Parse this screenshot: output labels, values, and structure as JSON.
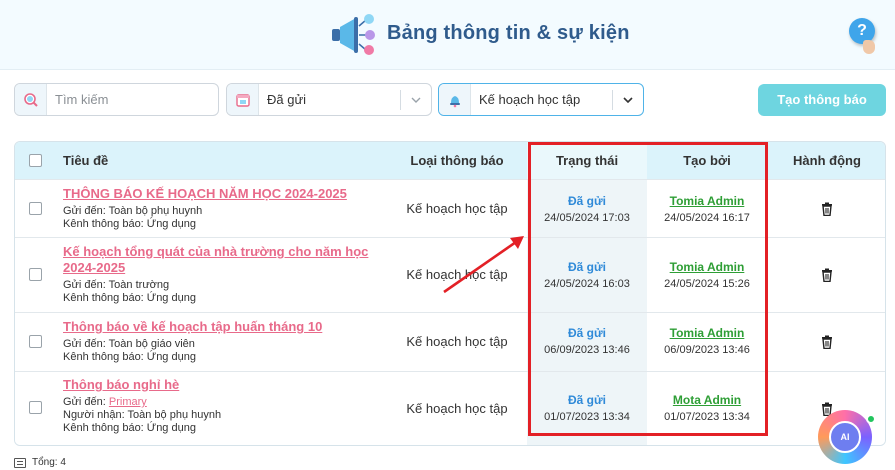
{
  "header": {
    "title": "Bảng thông tin & sự kiện",
    "help_label": "?"
  },
  "toolbar": {
    "search_placeholder": "Tìm kiếm",
    "status_filter": "Đã gửi",
    "type_filter": "Kế hoạch học tập",
    "create_label": "Tạo thông báo"
  },
  "table": {
    "headers": [
      "Tiêu đề",
      "Loại thông báo",
      "Trạng thái",
      "Tạo bởi",
      "Hành động"
    ],
    "rows": [
      {
        "title": "THÔNG BÁO KẾ HOẠCH NĂM HỌC 2024-2025",
        "send_to": "Gửi đến: Toàn bộ phụ huynh",
        "channel": "Kênh thông báo: Ứng dụng",
        "type": "Kế hoạch học tập",
        "status": "Đã gửi",
        "status_date": "24/05/2024 17:03",
        "creator": "Tomia Admin",
        "created_date": "24/05/2024 16:17"
      },
      {
        "title_line1": "Kế hoạch tổng quát của nhà trường cho năm học",
        "title_line2": "2024-2025",
        "send_to": "Gửi đến: Toàn trường",
        "channel": "Kênh thông báo: Ứng dụng",
        "type": "Kế hoạch học tập",
        "status": "Đã gửi",
        "status_date": "24/05/2024 16:03",
        "creator": "Tomia Admin",
        "created_date": "24/05/2024 15:26"
      },
      {
        "title": "Thông báo về kế hoạch tập huấn tháng 10",
        "send_to": "Gửi đến: Toàn bộ giáo viên",
        "channel": "Kênh thông báo: Ứng dụng",
        "type": "Kế hoạch học tập",
        "status": "Đã gửi",
        "status_date": "06/09/2023 13:46",
        "creator": "Tomia Admin",
        "created_date": "06/09/2023 13:46"
      },
      {
        "title": "Thông báo nghỉ hè",
        "send_to_prefix": "Gửi đến:",
        "send_to_link": "Primary",
        "recipient": "Người nhận: Toàn bộ phụ huynh",
        "channel": "Kênh thông báo: Ứng dụng",
        "type": "Kế hoạch học tập",
        "status": "Đã gửi",
        "status_date": "01/07/2023 13:34",
        "creator": "Mota Admin",
        "created_date": "01/07/2023 13:34"
      }
    ]
  },
  "footer": {
    "total": "Tổng: 4"
  },
  "ai_assistant": {
    "label": "AI"
  },
  "colors": {
    "accent": "#6ed5e0",
    "link_pink": "#e86a8a",
    "status_blue": "#2f8ad8",
    "creator_green": "#2e9e35",
    "highlight_red": "#e32026"
  }
}
